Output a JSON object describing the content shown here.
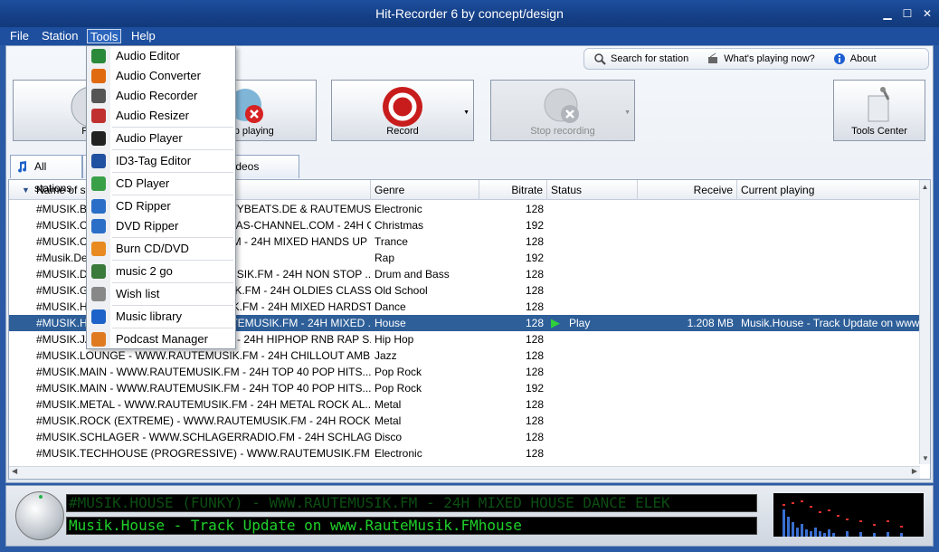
{
  "window": {
    "title": "Hit-Recorder 6 by concept/design"
  },
  "menubar": [
    "File",
    "Station",
    "Tools",
    "Help"
  ],
  "topbar": {
    "search": "Search for station",
    "whats_playing": "What's playing now?",
    "about": "About"
  },
  "toolbar": {
    "play": "Play",
    "stop_playing": "Stop playing",
    "record": "Record",
    "stop_recording": "Stop recording",
    "tools_center": "Tools Center"
  },
  "tabs": {
    "all_stations": "All stations",
    "music_videos": "Music videos"
  },
  "columns": {
    "name": "Name of station",
    "genre": "Genre",
    "bitrate": "Bitrate",
    "status": "Status",
    "receive": "Receive",
    "current": "Current playing"
  },
  "rows": [
    {
      "name": "#MUSIK.BIGCITYBEATS - WWW.BIGCITYBEATS.DE & RAUTEMUSIK.F...",
      "genre": "Electronic",
      "bitrate": "128",
      "status": "",
      "receive": "",
      "current": ""
    },
    {
      "name": "#MUSIK.CHRISTMAS - WWW.CHRISTMAS-CHANNEL.COM - 24H C...",
      "genre": "Christmas",
      "bitrate": "192",
      "status": "",
      "receive": "",
      "current": ""
    },
    {
      "name": "#MUSIK.CLUB - WWW.RAUTEMUSIK.FM - 24H MIXED HANDS UP ...",
      "genre": "Trance",
      "bitrate": "128",
      "status": "",
      "receive": "",
      "current": ""
    },
    {
      "name": "#Musik.Deutschrap",
      "genre": "Rap",
      "bitrate": "192",
      "status": "",
      "receive": "",
      "current": ""
    },
    {
      "name": "#MUSIK.DRUMSTEP - WWW.RAUTEMUSIK.FM - 24H NON STOP ...",
      "genre": "Drum and Bass",
      "bitrate": "128",
      "status": "",
      "receive": "",
      "current": ""
    },
    {
      "name": "#MUSIK.GOLDIES - WWW.RAUTEMUSIK.FM - 24H OLDIES CLASS...",
      "genre": "Old School",
      "bitrate": "128",
      "status": "",
      "receive": "",
      "current": ""
    },
    {
      "name": "#MUSIK.HARDER - WWW.RAUTEMUSIK.FM - 24H MIXED HARDST...",
      "genre": "Dance",
      "bitrate": "128",
      "status": "",
      "receive": "",
      "current": ""
    },
    {
      "name": "#MUSIK.HOUSE (FUNKY) - WWW.RAUTEMUSIK.FM - 24H MIXED ...",
      "genre": "House",
      "bitrate": "128",
      "status": "Play",
      "receive": "1.208 MB",
      "current": "Musik.House - Track Update on www"
    },
    {
      "name": "#MUSIK.JAM - WWW.RAUTEMUSIK.FM - 24H HIPHOP RNB RAP S...",
      "genre": "Hip Hop",
      "bitrate": "128",
      "status": "",
      "receive": "",
      "current": ""
    },
    {
      "name": "#MUSIK.LOUNGE - WWW.RAUTEMUSIK.FM - 24H CHILLOUT AMB...",
      "genre": "Jazz",
      "bitrate": "128",
      "status": "",
      "receive": "",
      "current": ""
    },
    {
      "name": "#MUSIK.MAIN - WWW.RAUTEMUSIK.FM - 24H TOP 40 POP HITS...",
      "genre": "Pop Rock",
      "bitrate": "128",
      "status": "",
      "receive": "",
      "current": ""
    },
    {
      "name": "#MUSIK.MAIN - WWW.RAUTEMUSIK.FM - 24H TOP 40 POP HITS...",
      "genre": "Pop Rock",
      "bitrate": "192",
      "status": "",
      "receive": "",
      "current": ""
    },
    {
      "name": "#MUSIK.METAL - WWW.RAUTEMUSIK.FM - 24H METAL ROCK AL...",
      "genre": "Metal",
      "bitrate": "128",
      "status": "",
      "receive": "",
      "current": ""
    },
    {
      "name": "#MUSIK.ROCK (EXTREME) - WWW.RAUTEMUSIK.FM - 24H ROCK ...",
      "genre": "Metal",
      "bitrate": "128",
      "status": "",
      "receive": "",
      "current": ""
    },
    {
      "name": "#MUSIK.SCHLAGER - WWW.SCHLAGERRADIO.FM - 24H SCHLAGE...",
      "genre": "Disco",
      "bitrate": "128",
      "status": "",
      "receive": "",
      "current": ""
    },
    {
      "name": "#MUSIK.TECHHOUSE (PROGRESSIVE) - WWW.RAUTEMUSIK.FM ...",
      "genre": "Electronic",
      "bitrate": "128",
      "status": "",
      "receive": "",
      "current": ""
    }
  ],
  "display": {
    "line1": "#MUSIK.HOUSE (FUNKY) - WWW.RAUTEMUSIK.FM - 24H MIXED HOUSE DANCE ELEK",
    "line2": "Musik.House - Track Update on www.RauteMusik.FMhouse"
  },
  "tools_menu": [
    {
      "label": "Audio Editor",
      "icon": "audio-editor-icon"
    },
    {
      "label": "Audio Converter",
      "icon": "audio-converter-icon"
    },
    {
      "label": "Audio Recorder",
      "icon": "audio-recorder-icon"
    },
    {
      "label": "Audio Resizer",
      "icon": "audio-resizer-icon"
    },
    {
      "label": "Audio Player",
      "icon": "audio-player-icon"
    },
    {
      "label": "ID3-Tag Editor",
      "icon": "id3-tag-icon"
    },
    {
      "label": "CD Player",
      "icon": "cd-player-icon"
    },
    {
      "label": "CD Ripper",
      "icon": "cd-ripper-icon"
    },
    {
      "label": "DVD Ripper",
      "icon": "dvd-ripper-icon"
    },
    {
      "label": "Burn CD/DVD",
      "icon": "burn-disc-icon"
    },
    {
      "label": "music 2 go",
      "icon": "music-2-go-icon"
    },
    {
      "label": "Wish list",
      "icon": "wish-list-icon"
    },
    {
      "label": "Music library",
      "icon": "music-library-icon"
    },
    {
      "label": "Podcast Manager",
      "icon": "podcast-icon"
    }
  ]
}
